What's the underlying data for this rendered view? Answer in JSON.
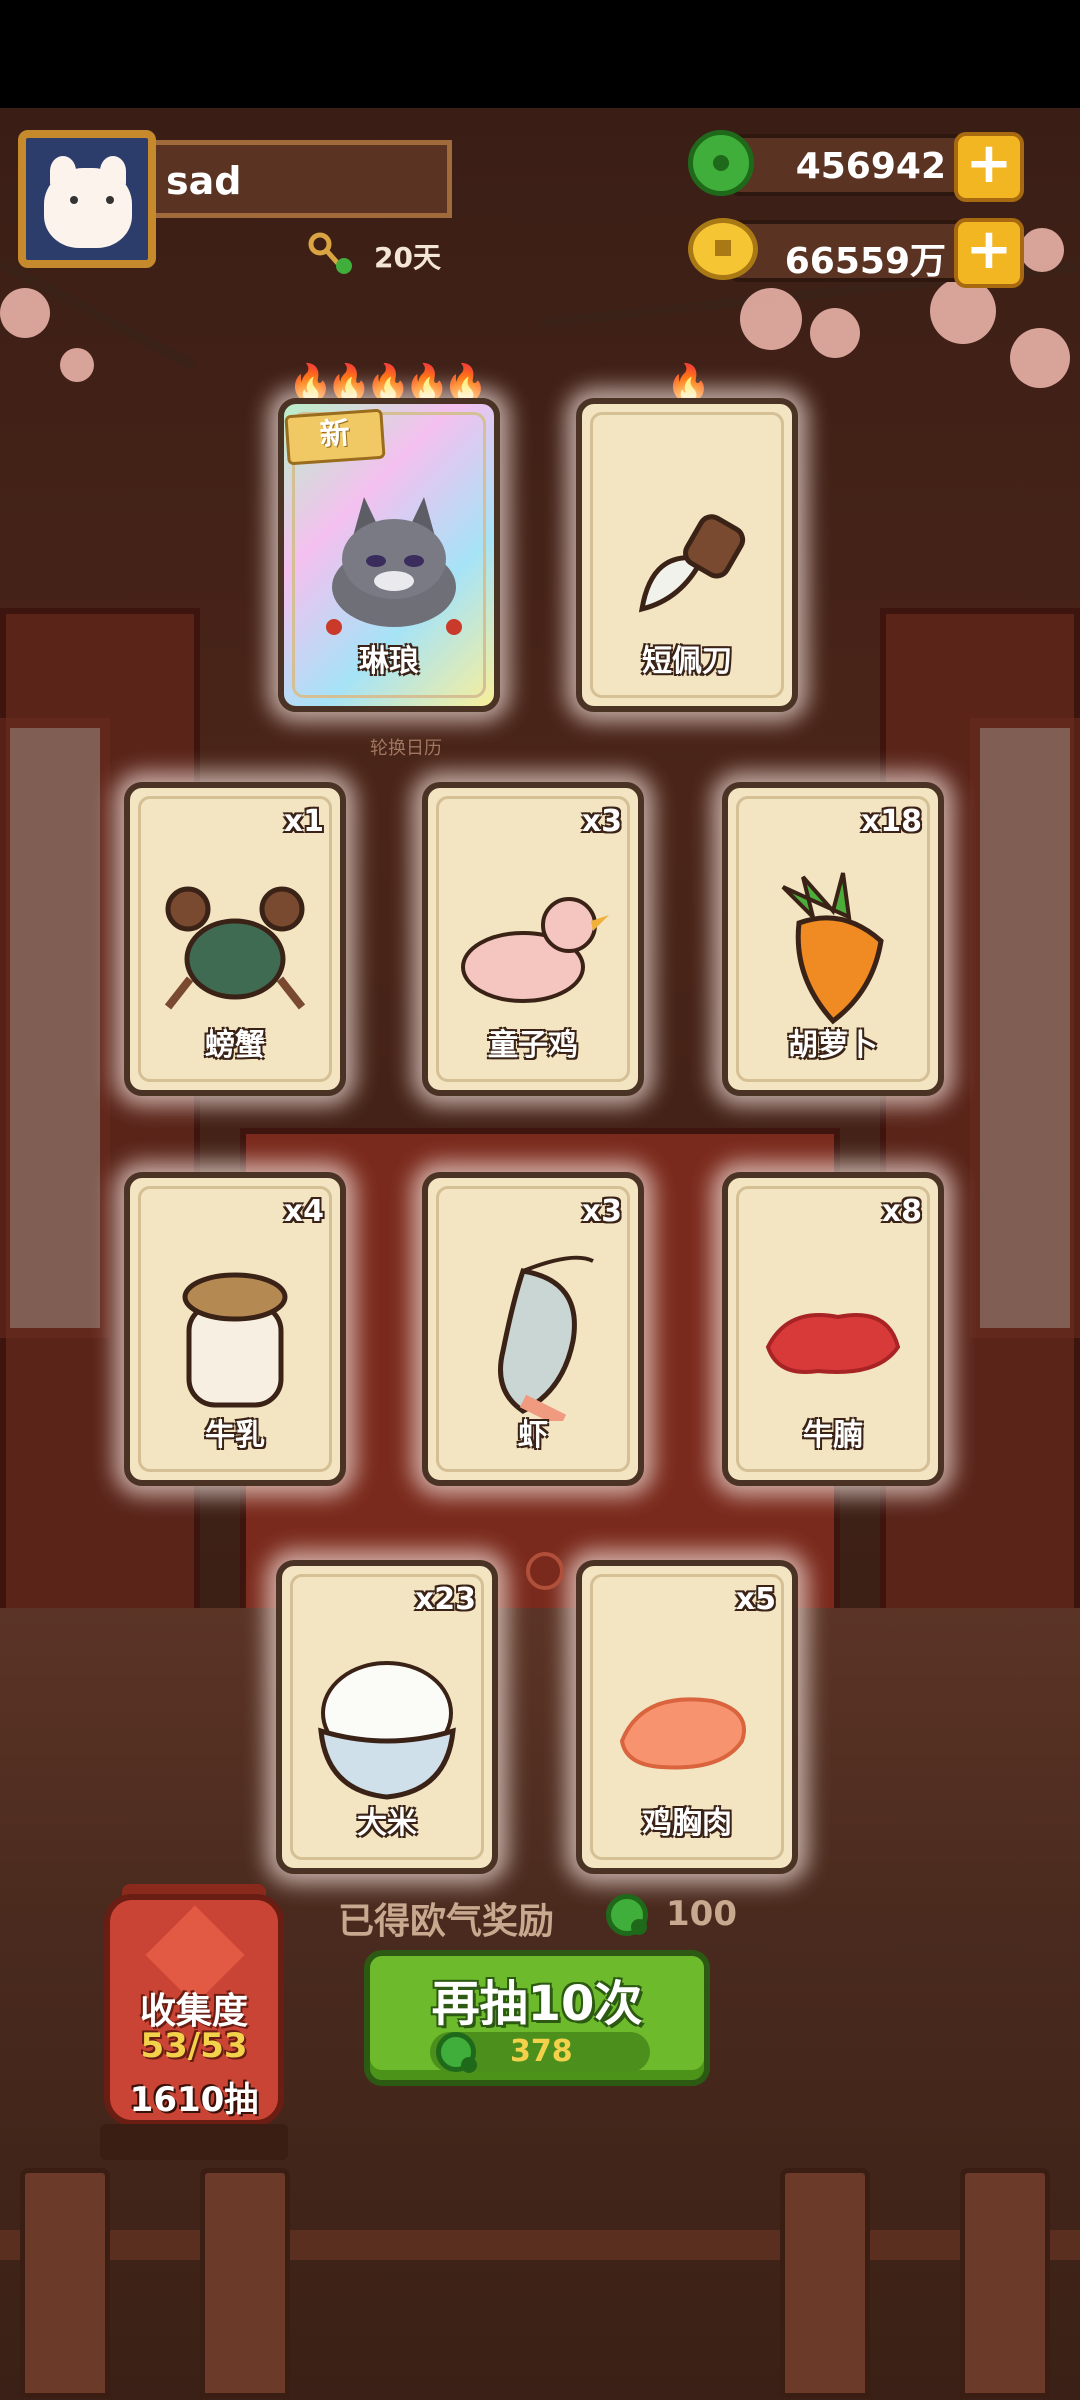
{
  "player": {
    "name": "sad",
    "days": "20天"
  },
  "currency": {
    "jade": "456942",
    "gold": "66559万"
  },
  "featured_cards": [
    {
      "label": "琳琅",
      "quantity": "",
      "new_tag": "新",
      "flames": 5
    },
    {
      "label": "短佩刀",
      "quantity": "",
      "flames": 1
    }
  ],
  "calendar_text": "轮换日历",
  "item_cards": [
    {
      "label": "螃蟹",
      "quantity": "x1"
    },
    {
      "label": "童子鸡",
      "quantity": "x3"
    },
    {
      "label": "胡萝卜",
      "quantity": "x18"
    },
    {
      "label": "牛乳",
      "quantity": "x4"
    },
    {
      "label": "虾",
      "quantity": "x3"
    },
    {
      "label": "牛腩",
      "quantity": "x8"
    },
    {
      "label": "大米",
      "quantity": "x23"
    },
    {
      "label": "鸡胸肉",
      "quantity": "x5"
    }
  ],
  "reward": {
    "label": "已得欧气奖励",
    "value": "100"
  },
  "draw_button": {
    "label": "再抽10次",
    "cost": "378"
  },
  "collection": {
    "label": "收集度",
    "progress": "53/53",
    "draws": "1610抽"
  },
  "colors": {
    "accent_green": "#6dbb2c",
    "gold": "#f3b623",
    "card_bg": "#f3e4c2"
  }
}
